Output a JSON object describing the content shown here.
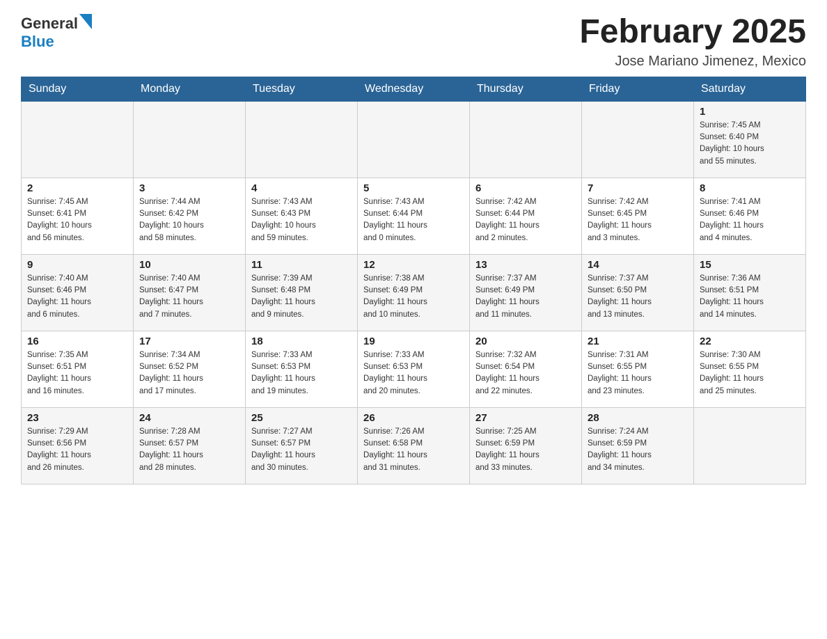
{
  "header": {
    "logo": {
      "general": "General",
      "blue": "Blue"
    },
    "title": "February 2025",
    "subtitle": "Jose Mariano Jimenez, Mexico"
  },
  "weekdays": [
    "Sunday",
    "Monday",
    "Tuesday",
    "Wednesday",
    "Thursday",
    "Friday",
    "Saturday"
  ],
  "weeks": [
    [
      {
        "day": "",
        "info": ""
      },
      {
        "day": "",
        "info": ""
      },
      {
        "day": "",
        "info": ""
      },
      {
        "day": "",
        "info": ""
      },
      {
        "day": "",
        "info": ""
      },
      {
        "day": "",
        "info": ""
      },
      {
        "day": "1",
        "info": "Sunrise: 7:45 AM\nSunset: 6:40 PM\nDaylight: 10 hours\nand 55 minutes."
      }
    ],
    [
      {
        "day": "2",
        "info": "Sunrise: 7:45 AM\nSunset: 6:41 PM\nDaylight: 10 hours\nand 56 minutes."
      },
      {
        "day": "3",
        "info": "Sunrise: 7:44 AM\nSunset: 6:42 PM\nDaylight: 10 hours\nand 58 minutes."
      },
      {
        "day": "4",
        "info": "Sunrise: 7:43 AM\nSunset: 6:43 PM\nDaylight: 10 hours\nand 59 minutes."
      },
      {
        "day": "5",
        "info": "Sunrise: 7:43 AM\nSunset: 6:44 PM\nDaylight: 11 hours\nand 0 minutes."
      },
      {
        "day": "6",
        "info": "Sunrise: 7:42 AM\nSunset: 6:44 PM\nDaylight: 11 hours\nand 2 minutes."
      },
      {
        "day": "7",
        "info": "Sunrise: 7:42 AM\nSunset: 6:45 PM\nDaylight: 11 hours\nand 3 minutes."
      },
      {
        "day": "8",
        "info": "Sunrise: 7:41 AM\nSunset: 6:46 PM\nDaylight: 11 hours\nand 4 minutes."
      }
    ],
    [
      {
        "day": "9",
        "info": "Sunrise: 7:40 AM\nSunset: 6:46 PM\nDaylight: 11 hours\nand 6 minutes."
      },
      {
        "day": "10",
        "info": "Sunrise: 7:40 AM\nSunset: 6:47 PM\nDaylight: 11 hours\nand 7 minutes."
      },
      {
        "day": "11",
        "info": "Sunrise: 7:39 AM\nSunset: 6:48 PM\nDaylight: 11 hours\nand 9 minutes."
      },
      {
        "day": "12",
        "info": "Sunrise: 7:38 AM\nSunset: 6:49 PM\nDaylight: 11 hours\nand 10 minutes."
      },
      {
        "day": "13",
        "info": "Sunrise: 7:37 AM\nSunset: 6:49 PM\nDaylight: 11 hours\nand 11 minutes."
      },
      {
        "day": "14",
        "info": "Sunrise: 7:37 AM\nSunset: 6:50 PM\nDaylight: 11 hours\nand 13 minutes."
      },
      {
        "day": "15",
        "info": "Sunrise: 7:36 AM\nSunset: 6:51 PM\nDaylight: 11 hours\nand 14 minutes."
      }
    ],
    [
      {
        "day": "16",
        "info": "Sunrise: 7:35 AM\nSunset: 6:51 PM\nDaylight: 11 hours\nand 16 minutes."
      },
      {
        "day": "17",
        "info": "Sunrise: 7:34 AM\nSunset: 6:52 PM\nDaylight: 11 hours\nand 17 minutes."
      },
      {
        "day": "18",
        "info": "Sunrise: 7:33 AM\nSunset: 6:53 PM\nDaylight: 11 hours\nand 19 minutes."
      },
      {
        "day": "19",
        "info": "Sunrise: 7:33 AM\nSunset: 6:53 PM\nDaylight: 11 hours\nand 20 minutes."
      },
      {
        "day": "20",
        "info": "Sunrise: 7:32 AM\nSunset: 6:54 PM\nDaylight: 11 hours\nand 22 minutes."
      },
      {
        "day": "21",
        "info": "Sunrise: 7:31 AM\nSunset: 6:55 PM\nDaylight: 11 hours\nand 23 minutes."
      },
      {
        "day": "22",
        "info": "Sunrise: 7:30 AM\nSunset: 6:55 PM\nDaylight: 11 hours\nand 25 minutes."
      }
    ],
    [
      {
        "day": "23",
        "info": "Sunrise: 7:29 AM\nSunset: 6:56 PM\nDaylight: 11 hours\nand 26 minutes."
      },
      {
        "day": "24",
        "info": "Sunrise: 7:28 AM\nSunset: 6:57 PM\nDaylight: 11 hours\nand 28 minutes."
      },
      {
        "day": "25",
        "info": "Sunrise: 7:27 AM\nSunset: 6:57 PM\nDaylight: 11 hours\nand 30 minutes."
      },
      {
        "day": "26",
        "info": "Sunrise: 7:26 AM\nSunset: 6:58 PM\nDaylight: 11 hours\nand 31 minutes."
      },
      {
        "day": "27",
        "info": "Sunrise: 7:25 AM\nSunset: 6:59 PM\nDaylight: 11 hours\nand 33 minutes."
      },
      {
        "day": "28",
        "info": "Sunrise: 7:24 AM\nSunset: 6:59 PM\nDaylight: 11 hours\nand 34 minutes."
      },
      {
        "day": "",
        "info": ""
      }
    ]
  ]
}
